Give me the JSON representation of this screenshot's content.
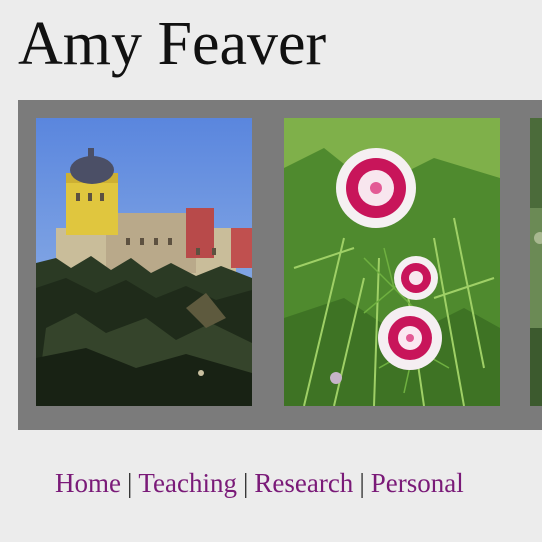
{
  "site": {
    "title": "Amy Feaver"
  },
  "gallery": {
    "photos": [
      {
        "icon": "castle-photo"
      },
      {
        "icon": "flower-photo"
      },
      {
        "icon": "garden-photo"
      }
    ]
  },
  "nav": {
    "items": [
      {
        "label": "Home"
      },
      {
        "label": "Teaching"
      },
      {
        "label": "Research"
      },
      {
        "label": "Personal"
      }
    ],
    "separator": "|"
  },
  "colors": {
    "background": "#ececec",
    "gallery_frame": "#7b7b7b",
    "link": "#7a1a78",
    "title": "#111111"
  }
}
